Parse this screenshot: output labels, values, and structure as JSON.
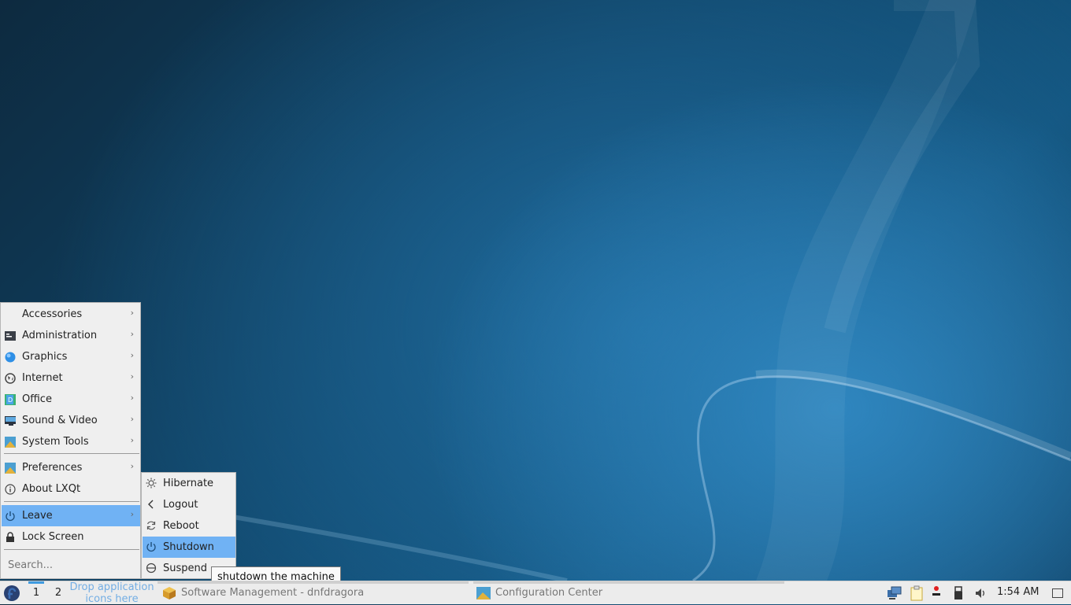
{
  "main_menu": {
    "items": [
      {
        "label": "Accessories",
        "icon": "accessories-icon",
        "submenu": true
      },
      {
        "label": "Administration",
        "icon": "administration-icon",
        "submenu": true
      },
      {
        "label": "Graphics",
        "icon": "graphics-icon",
        "submenu": true
      },
      {
        "label": "Internet",
        "icon": "internet-icon",
        "submenu": true
      },
      {
        "label": "Office",
        "icon": "office-icon",
        "submenu": true
      },
      {
        "label": "Sound & Video",
        "icon": "sound-video-icon",
        "submenu": true
      },
      {
        "label": "System Tools",
        "icon": "system-tools-icon",
        "submenu": true
      },
      {
        "label": "Preferences",
        "icon": "preferences-icon",
        "submenu": true
      },
      {
        "label": "About LXQt",
        "icon": "info-icon",
        "submenu": false
      },
      {
        "label": "Leave",
        "icon": "power-icon",
        "submenu": true,
        "active": true
      },
      {
        "label": "Lock Screen",
        "icon": "lock-icon",
        "submenu": false
      }
    ],
    "search_placeholder": "Search..."
  },
  "leave_menu": {
    "items": [
      {
        "label": "Hibernate",
        "icon": "hibernate-icon"
      },
      {
        "label": "Logout",
        "icon": "logout-icon"
      },
      {
        "label": "Reboot",
        "icon": "reboot-icon"
      },
      {
        "label": "Shutdown",
        "icon": "power-icon",
        "active": true
      },
      {
        "label": "Suspend",
        "icon": "suspend-icon"
      }
    ]
  },
  "tooltip": "shutdown the machine",
  "taskbar": {
    "desktops": [
      "1",
      "2"
    ],
    "current_desktop": "1",
    "quicklaunch_line1": "Drop application",
    "quicklaunch_line2": "icons here",
    "tasks": [
      {
        "label": "Software Management - dnfdragora",
        "icon": "package-icon"
      },
      {
        "label": "Configuration Center",
        "icon": "config-center-icon"
      }
    ],
    "tray_icons": [
      "network-icon",
      "clipboard-icon",
      "notification-icon",
      "usb-icon",
      "volume-icon"
    ],
    "clock": "1:54 AM"
  },
  "colors": {
    "accent": "#70b2f4",
    "menu_bg": "#efefef",
    "taskbar_bg": "#ececec"
  }
}
